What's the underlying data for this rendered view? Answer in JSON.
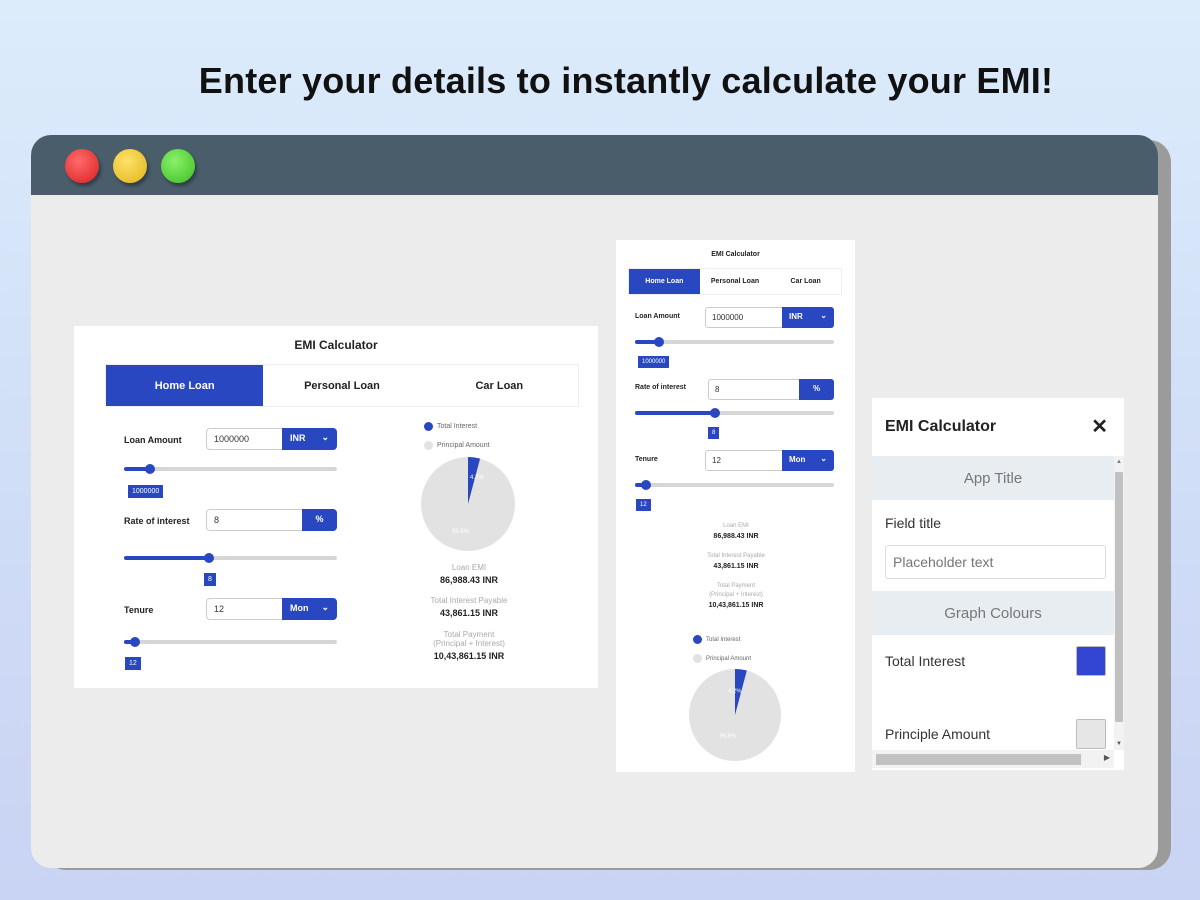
{
  "headline": "Enter your details to instantly calculate your EMI!",
  "window": {
    "controls": [
      "close",
      "minimize",
      "maximize"
    ]
  },
  "desktop_calc": {
    "title": "EMI Calculator",
    "tabs": [
      {
        "label": "Home Loan",
        "active": true
      },
      {
        "label": "Personal Loan",
        "active": false
      },
      {
        "label": "Car Loan",
        "active": false
      }
    ],
    "loan_amount": {
      "label": "Loan Amount",
      "value": "1000000",
      "unit": "INR",
      "slider_fraction": 0.12,
      "tooltip": "1000000"
    },
    "rate": {
      "label": "Rate of interest",
      "value": "8",
      "unit": "%",
      "slider_fraction": 0.4,
      "tooltip": "8"
    },
    "tenure": {
      "label": "Tenure",
      "value": "12",
      "unit": "Mon",
      "slider_fraction": 0.05,
      "tooltip": "12"
    },
    "legend": [
      {
        "label": "Total Interest",
        "color": "#2847c0"
      },
      {
        "label": "Principal Amount",
        "color": "#e2e2e2"
      }
    ],
    "pie": {
      "interest_label": "4.2%",
      "principal_label": "95.8%",
      "interest_percent": 4.2
    },
    "stats": [
      {
        "label": "Loan EMI",
        "value": "86,988.43 INR"
      },
      {
        "label": "Total Interest Payable",
        "value": "43,861.15 INR"
      },
      {
        "label": "Total Payment",
        "label2": "(Principal + Interest)",
        "value": "10,43,861.15 INR"
      }
    ]
  },
  "mobile_calc": {
    "title": "EMI Calculator",
    "tabs": [
      {
        "label": "Home Loan",
        "active": true
      },
      {
        "label": "Personal Loan",
        "active": false
      },
      {
        "label": "Car Loan",
        "active": false
      }
    ],
    "loan_amount": {
      "label": "Loan Amount",
      "value": "1000000",
      "unit": "INR",
      "tooltip": "1000000"
    },
    "rate": {
      "label": "Rate of interest",
      "value": "8",
      "unit": "%",
      "tooltip": "8"
    },
    "tenure": {
      "label": "Tenure",
      "value": "12",
      "unit": "Mon",
      "tooltip": "12"
    },
    "stats": [
      {
        "label": "Loan EMI",
        "value": "86,988.43 INR"
      },
      {
        "label": "Total Interest Payable",
        "value": "43,861.15 INR"
      },
      {
        "label": "Total Payment",
        "label2": "(Principal + Interest)",
        "value": "10,43,861.15 INR"
      }
    ],
    "legend": [
      {
        "label": "Total Interest",
        "color": "#2847c0"
      },
      {
        "label": "Principal Amount",
        "color": "#e2e2e2"
      }
    ],
    "pie": {
      "interest_label": "4.2%",
      "principal_label": "95.8%"
    }
  },
  "settings": {
    "title": "EMI Calculator",
    "close_icon": "close-icon",
    "section_app": "App Title",
    "field_title": "Field title",
    "field_placeholder": "Placeholder text",
    "section_graph": "Graph Colours",
    "total_interest_label": "Total Interest",
    "total_interest_color": "#3246d3",
    "principle_label": "Principle Amount",
    "principle_color": "#e6e6e6"
  }
}
